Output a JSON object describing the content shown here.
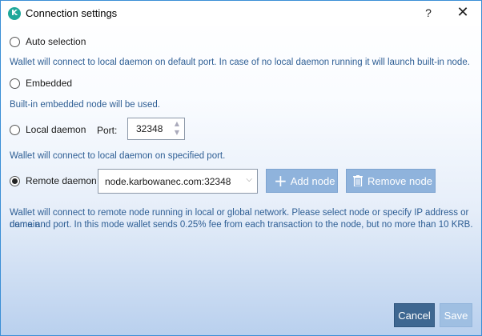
{
  "window": {
    "title": "Connection settings",
    "app_icon_letter": "K",
    "help_label": "?",
    "close_label": "✕"
  },
  "options": {
    "auto": {
      "label": "Auto selection",
      "selected": false,
      "description": "Wallet will connect to local daemon on default port. In case of no local daemon running it will launch built-in node."
    },
    "embedded": {
      "label": "Embedded",
      "selected": false,
      "description": "Built-in embedded node will be used."
    },
    "local": {
      "label": "Local daemon",
      "selected": false,
      "port_label": "Port:",
      "port_value": "32348",
      "description": "Wallet will connect to local daemon on specified port."
    },
    "remote": {
      "label": "Remote daemon",
      "selected": true,
      "node_value": "node.karbowanec.com:32348",
      "add_node_label": "Add node",
      "remove_node_label": "Remove node",
      "description_line1": "Wallet will connect to remote node running in local or global network. Please select node or specify IP address or domain",
      "description_line2": "name and port. In this mode wallet sends 0.25% fee from each transaction to the node, but no more than 10 KRB."
    }
  },
  "footer": {
    "cancel_label": "Cancel",
    "save_label": "Save"
  },
  "icons": {
    "app": "karbo-logo-icon",
    "add": "plus-icon",
    "remove": "trash-icon",
    "dropdown": "chevron-down-icon"
  },
  "colors": {
    "description_text": "#2e5e94",
    "button_light": "#8fb3dc",
    "button_primary": "#3e6791",
    "app_icon": "#1fa89a"
  }
}
